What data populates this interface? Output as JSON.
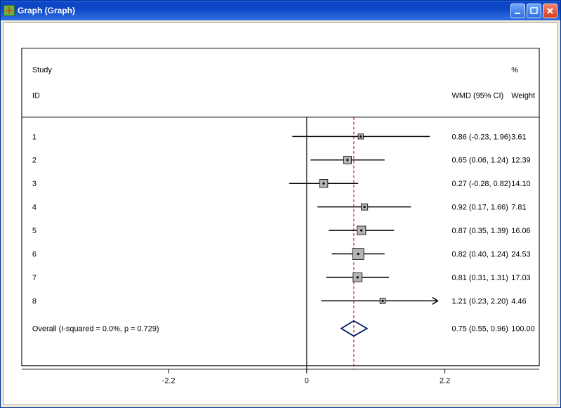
{
  "window": {
    "title": "Graph (Graph)"
  },
  "chart_data": {
    "type": "forest-plot",
    "columns": {
      "study_top": "Study",
      "study_bottom": "ID",
      "effect": "WMD (95% CI)",
      "weight_top": "%",
      "weight_bottom": "Weight"
    },
    "xaxis": {
      "ticks": [
        -2.2,
        0,
        2.2
      ],
      "tick_labels": [
        "-2.2",
        "0",
        "2.2"
      ],
      "range": [
        -2.2,
        2.2
      ]
    },
    "overall": {
      "label": "Overall  (I-squared = 0.0%, p = 0.729)",
      "est": 0.75,
      "lo": 0.55,
      "hi": 0.96,
      "effect_text": "0.75 (0.55, 0.96)",
      "weight_text": "100.00"
    },
    "studies": [
      {
        "id": "1",
        "est": 0.86,
        "lo": -0.23,
        "hi": 1.96,
        "effect_text": "0.86 (-0.23, 1.96)",
        "weight": 3.61,
        "weight_text": "3.61"
      },
      {
        "id": "2",
        "est": 0.65,
        "lo": 0.06,
        "hi": 1.24,
        "effect_text": "0.65 (0.06, 1.24)",
        "weight": 12.39,
        "weight_text": "12.39"
      },
      {
        "id": "3",
        "est": 0.27,
        "lo": -0.28,
        "hi": 0.82,
        "effect_text": "0.27 (-0.28, 0.82)",
        "weight": 14.1,
        "weight_text": "14.10"
      },
      {
        "id": "4",
        "est": 0.92,
        "lo": 0.17,
        "hi": 1.66,
        "effect_text": "0.92 (0.17, 1.66)",
        "weight": 7.81,
        "weight_text": "7.81"
      },
      {
        "id": "5",
        "est": 0.87,
        "lo": 0.35,
        "hi": 1.39,
        "effect_text": "0.87 (0.35, 1.39)",
        "weight": 16.06,
        "weight_text": "16.06"
      },
      {
        "id": "6",
        "est": 0.82,
        "lo": 0.4,
        "hi": 1.24,
        "effect_text": "0.82 (0.40, 1.24)",
        "weight": 24.53,
        "weight_text": "24.53"
      },
      {
        "id": "7",
        "est": 0.81,
        "lo": 0.31,
        "hi": 1.31,
        "effect_text": "0.81 (0.31, 1.31)",
        "weight": 17.03,
        "weight_text": "17.03"
      },
      {
        "id": "8",
        "est": 1.21,
        "lo": 0.23,
        "hi": 2.2,
        "effect_text": "1.21 (0.23, 2.20)",
        "weight": 4.46,
        "weight_text": "4.46"
      }
    ]
  }
}
